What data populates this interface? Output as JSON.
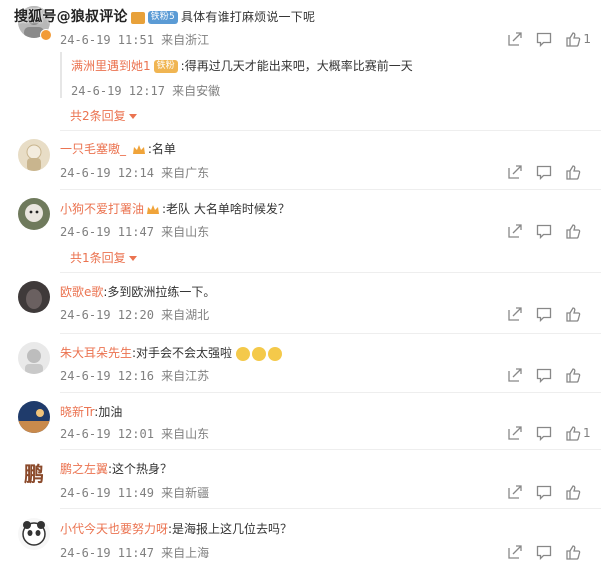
{
  "watermark": {
    "text": "搜狐号@狼叔评论"
  },
  "top_comment": {
    "badge": "铁粉5",
    "text": "具体有谁打麻烦说一下呢",
    "time": "24-6-19 11:51",
    "source": "来自浙江",
    "likes": "1",
    "reply": {
      "name": "满洲里遇到她1",
      "badge": "铁粉",
      "text": ":得再过几天才能出来吧，大概率比赛前一天",
      "time": "24-6-19 12:17",
      "source": "来自安徽"
    },
    "more_replies": "共2条回复"
  },
  "comments": [
    {
      "name": "一只毛塞嗷_",
      "text": ":名单",
      "time": "24-6-19 12:14",
      "source": "来自广东",
      "likes": ""
    },
    {
      "name": "小狗不爱打署油",
      "text": ":老队 大名单啥时候发？",
      "time": "24-6-19 11:47",
      "source": "来自山东",
      "likes": "",
      "more_replies": "共1条回复"
    },
    {
      "name": "欧歌e歌",
      "text": ":多到欧洲拉练一下。",
      "time": "24-6-19 12:20",
      "source": "来自湖北",
      "likes": ""
    },
    {
      "name": "朱大耳朵先生",
      "text": ":对手会不会太强啦",
      "time": "24-6-19 12:16",
      "source": "来自江苏",
      "likes": ""
    },
    {
      "name": "晓新Tr",
      "text": ":加油",
      "time": "24-6-19 12:01",
      "source": "来自山东",
      "likes": "1"
    },
    {
      "name": "鹏之左翼",
      "text": ":这个热身？",
      "time": "24-6-19 11:49",
      "source": "来自新疆",
      "likes": ""
    },
    {
      "name": "小代今天也要努力呀",
      "text": ":是海报上这几位去吗？",
      "time": "24-6-19 11:47",
      "source": "来自上海",
      "likes": ""
    }
  ],
  "colors": {
    "name": "#eb7350",
    "meta": "#808080",
    "text": "#333333"
  }
}
